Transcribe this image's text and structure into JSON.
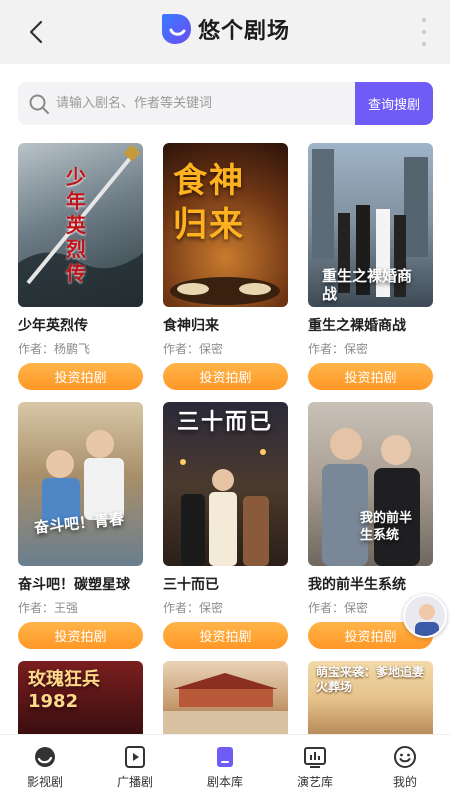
{
  "header": {
    "title": "悠个剧场"
  },
  "search": {
    "placeholder": "请输入剧名、作者等关键词",
    "button_label": "查询搜剧"
  },
  "cards": [
    {
      "title": "少年英烈传",
      "author": "作者：杨鹏飞",
      "button": "投资拍剧",
      "poster_text": "少年英烈传"
    },
    {
      "title": "食神归来",
      "author": "作者：保密",
      "button": "投资拍剧",
      "poster_text": "食神归来"
    },
    {
      "title": "重生之裸婚商战",
      "author": "作者：保密",
      "button": "投资拍剧",
      "poster_text": "重生之裸婚商战"
    },
    {
      "title": "奋斗吧！碳塑星球",
      "author": "作者：王强",
      "button": "投资拍剧",
      "poster_text": "奋斗吧！青春"
    },
    {
      "title": "三十而已",
      "author": "作者：保密",
      "button": "投资拍剧",
      "poster_text": "三十而已"
    },
    {
      "title": "我的前半生系统",
      "author": "作者：保密",
      "button": "投资拍剧",
      "poster_text": "我的前半生系统"
    },
    {
      "title": "",
      "author": "",
      "button": "",
      "poster_text": "玫瑰狂兵 1982"
    },
    {
      "title": "",
      "author": "",
      "button": "",
      "poster_text": ""
    },
    {
      "title": "",
      "author": "",
      "button": "",
      "poster_text": "萌宝来袭：爹地追妻火葬场"
    }
  ],
  "tabs": [
    {
      "label": "影视剧",
      "icon": "film-reel-icon"
    },
    {
      "label": "广播剧",
      "icon": "play-box-icon"
    },
    {
      "label": "剧本库",
      "icon": "script-icon",
      "active": true
    },
    {
      "label": "演艺库",
      "icon": "chart-board-icon"
    },
    {
      "label": "我的",
      "icon": "smiley-icon"
    }
  ],
  "colors": {
    "accent": "#6f5cf6",
    "button_orange": "#ff9f30"
  }
}
